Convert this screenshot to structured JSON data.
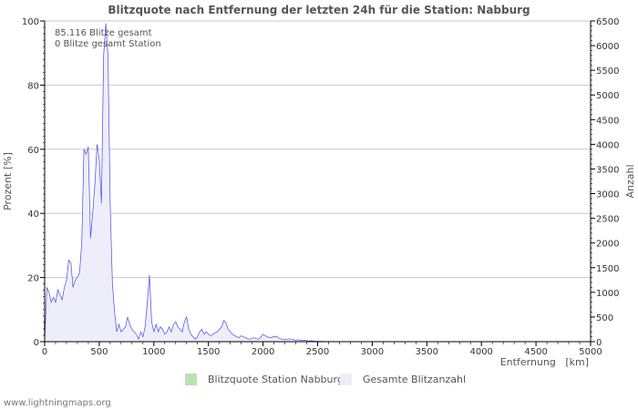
{
  "chart_data": {
    "type": "area",
    "title": "Blitzquote nach Entfernung der letzten 24h für die Station: Nabburg",
    "xlabel": "Entfernung   [km]",
    "ylabel_left": "Prozent   [%]",
    "ylabel_right": "Anzahl",
    "xlim": [
      0,
      5000
    ],
    "ylim_left": [
      0,
      100
    ],
    "ylim_right": [
      0,
      6500
    ],
    "x_ticks": [
      0,
      500,
      1000,
      1500,
      2000,
      2500,
      3000,
      3500,
      4000,
      4500,
      5000
    ],
    "y_left_ticks": [
      0,
      20,
      40,
      60,
      80,
      100
    ],
    "y_right_ticks": [
      0,
      500,
      1000,
      1500,
      2000,
      2500,
      3000,
      3500,
      4000,
      4500,
      5000,
      5500,
      6000,
      6500
    ],
    "grid": true,
    "annotations": [
      "85.116 Blitze gesamt",
      "0 Blitze gesamt Station"
    ],
    "legend": [
      "Blitzquote Station Nabburg",
      "Gesamte Blitzanzahl"
    ],
    "series": [
      {
        "name": "Blitzquote Station Nabburg",
        "axis": "left",
        "color": "#b9e3b0",
        "x": [],
        "y": []
      },
      {
        "name": "Gesamte Blitzanzahl",
        "axis": "right",
        "color": "#4a4ae6",
        "fill": "#eeeefa",
        "x": [
          0,
          20,
          40,
          60,
          80,
          100,
          120,
          140,
          160,
          180,
          200,
          220,
          240,
          260,
          280,
          300,
          320,
          340,
          360,
          380,
          400,
          420,
          440,
          460,
          480,
          500,
          520,
          540,
          560,
          580,
          600,
          620,
          640,
          660,
          680,
          700,
          720,
          740,
          760,
          780,
          800,
          820,
          840,
          860,
          880,
          900,
          920,
          940,
          960,
          980,
          1000,
          1020,
          1040,
          1060,
          1080,
          1100,
          1120,
          1140,
          1160,
          1180,
          1200,
          1220,
          1240,
          1260,
          1280,
          1300,
          1320,
          1340,
          1360,
          1380,
          1400,
          1420,
          1440,
          1460,
          1480,
          1500,
          1520,
          1540,
          1560,
          1580,
          1600,
          1620,
          1640,
          1660,
          1680,
          1700,
          1720,
          1740,
          1760,
          1780,
          1800,
          1820,
          1840,
          1860,
          1880,
          1900,
          1920,
          1940,
          1960,
          1980,
          2000,
          2020,
          2040,
          2060,
          2080,
          2100,
          2120,
          2140,
          2160,
          2180,
          2200,
          2220,
          2240,
          2260,
          2280,
          2300,
          2320,
          2340,
          2360,
          2380,
          2400,
          2420,
          2440,
          2460,
          2480,
          2500,
          2520,
          2540,
          2560,
          2580,
          2600,
          2620,
          2640,
          2660,
          2680,
          2700
        ],
        "y": [
          0,
          1100,
          1000,
          800,
          900,
          800,
          1050,
          950,
          850,
          1100,
          1250,
          1650,
          1600,
          1100,
          1250,
          1300,
          1400,
          2000,
          3900,
          3800,
          3950,
          2100,
          2600,
          3200,
          4000,
          3700,
          2800,
          5800,
          6450,
          5800,
          2800,
          1200,
          600,
          200,
          350,
          200,
          250,
          300,
          500,
          350,
          250,
          200,
          150,
          50,
          200,
          100,
          300,
          800,
          1350,
          400,
          200,
          350,
          200,
          300,
          250,
          150,
          200,
          300,
          200,
          350,
          400,
          300,
          250,
          200,
          400,
          500,
          250,
          150,
          100,
          50,
          100,
          200,
          250,
          150,
          200,
          150,
          120,
          150,
          180,
          200,
          250,
          300,
          430,
          380,
          250,
          200,
          150,
          120,
          100,
          80,
          120,
          100,
          80,
          60,
          50,
          70,
          80,
          60,
          50,
          100,
          150,
          120,
          100,
          80,
          90,
          100,
          110,
          80,
          60,
          50,
          40,
          50,
          60,
          50,
          40,
          30,
          40,
          30,
          20,
          30,
          20,
          10,
          20,
          10,
          10,
          5,
          10,
          5,
          5,
          0,
          5,
          0,
          0,
          0,
          0,
          0
        ]
      }
    ]
  },
  "footer": "www.lightningmaps.org"
}
